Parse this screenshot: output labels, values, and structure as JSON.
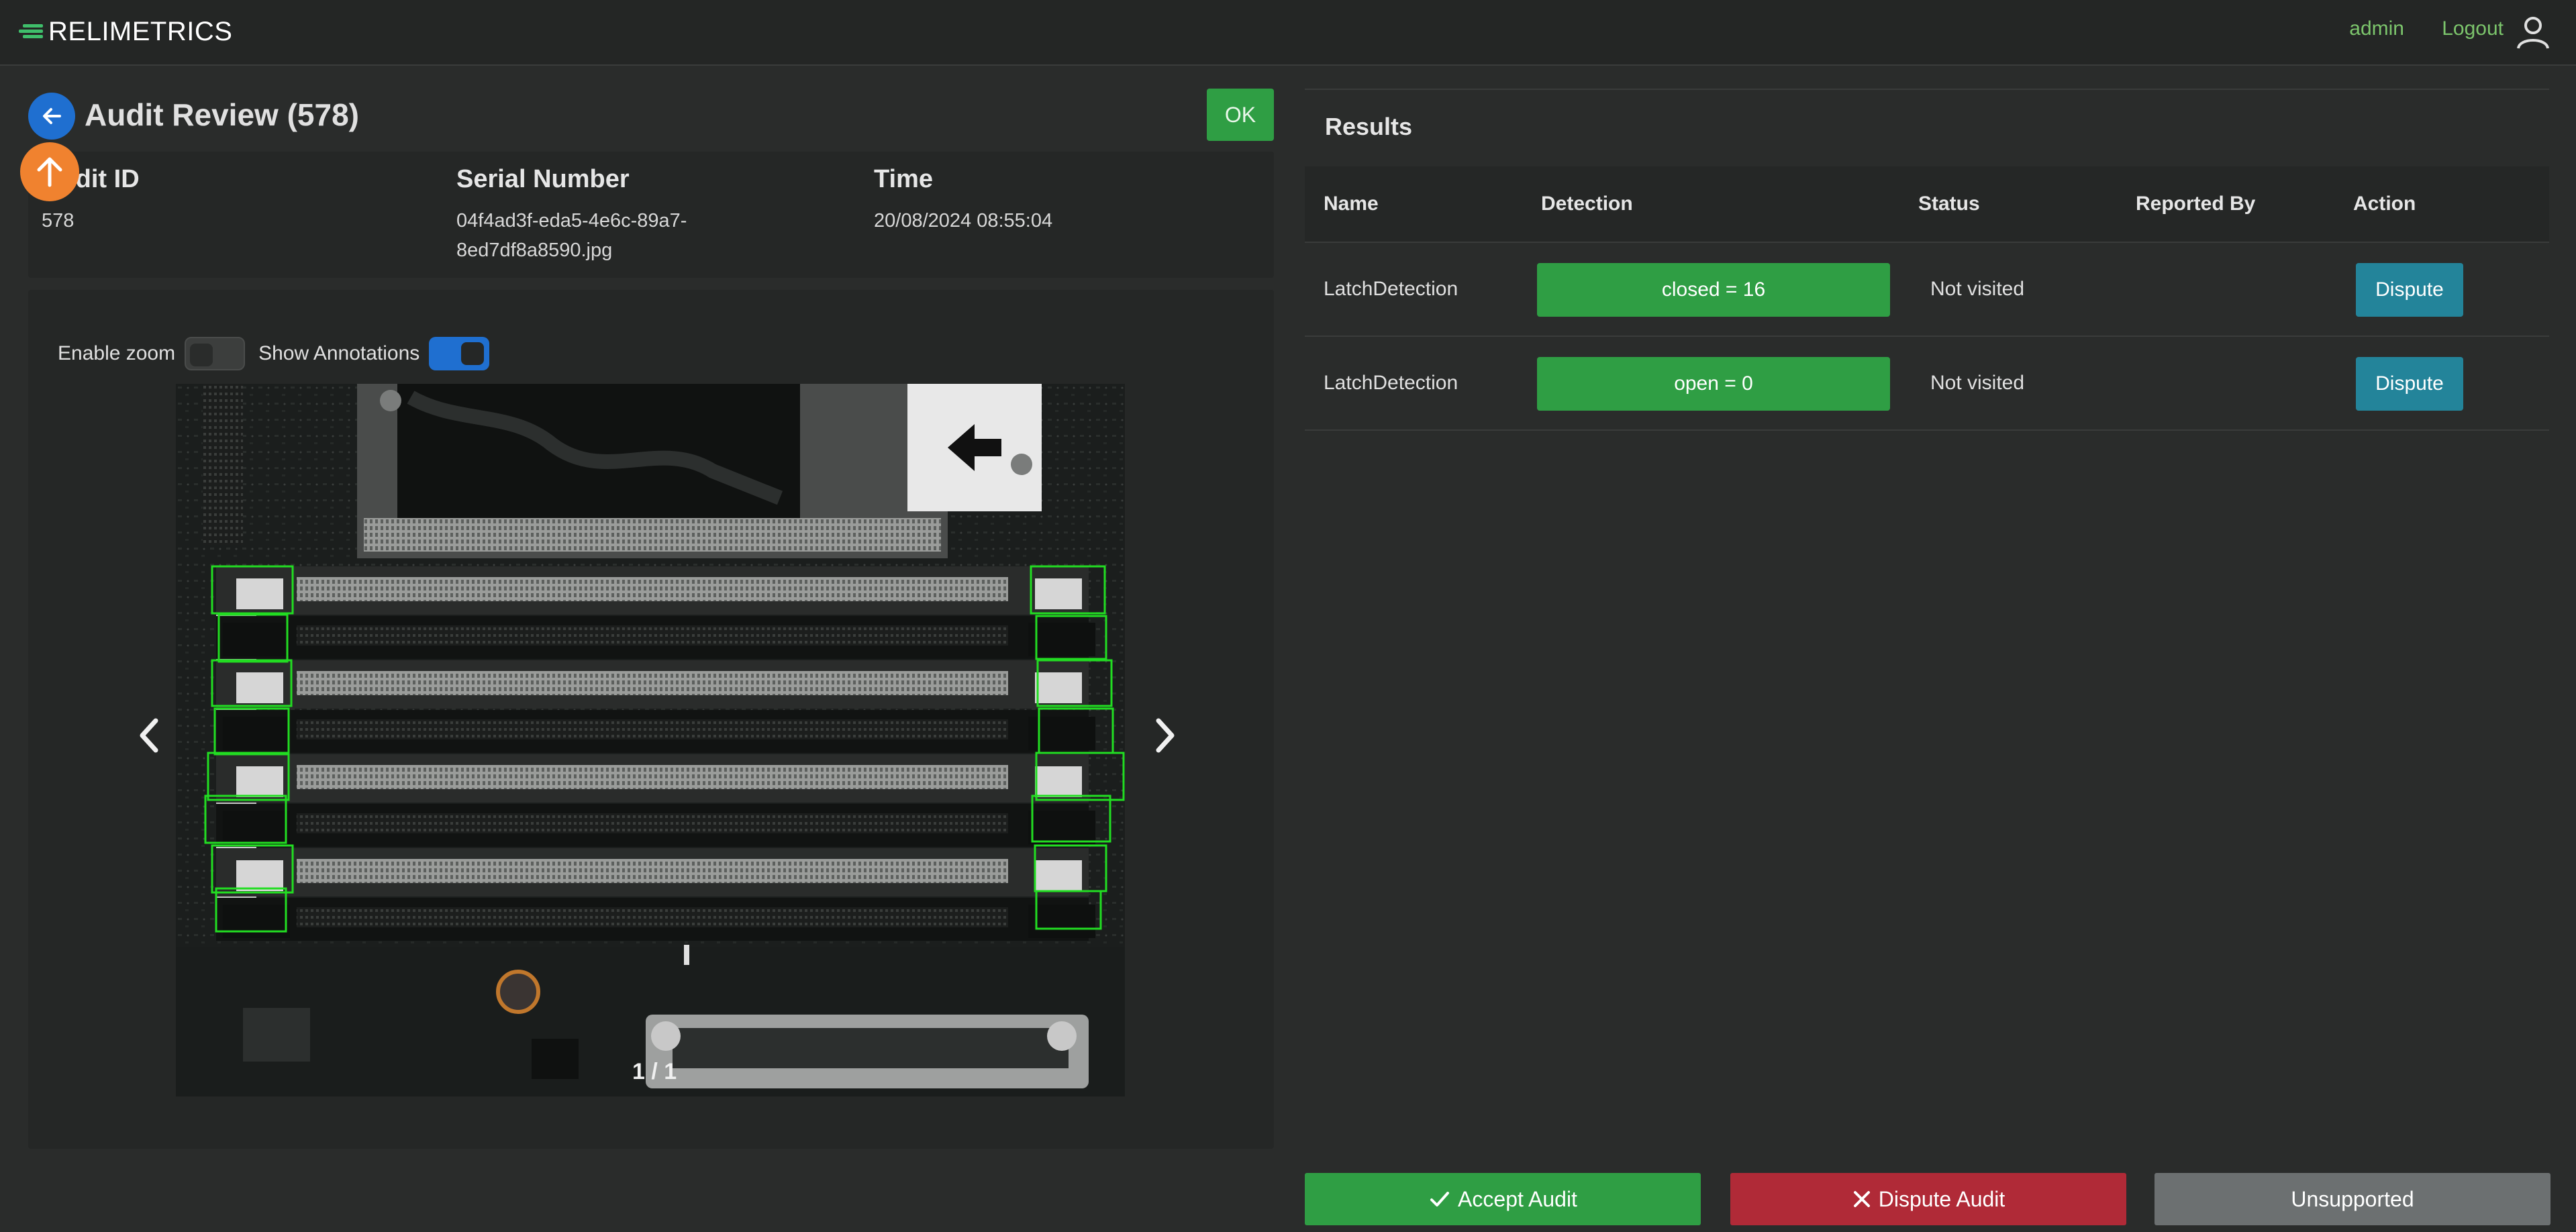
{
  "app": {
    "brand": "RELIMETRICS"
  },
  "nav": {
    "user": "admin",
    "logout": "Logout",
    "user_icon": "user-icon"
  },
  "page": {
    "title": "Audit Review (578)",
    "ok_label": "OK",
    "back_icon": "arrow-left-icon",
    "upload_icon": "arrow-up-icon"
  },
  "info": {
    "audit_id_label": "Audit ID",
    "audit_id_value": "578",
    "serial_label": "Serial Number",
    "serial_line1": "04f4ad3f-eda5-4e6c-89a7-",
    "serial_line2": "8ed7df8a8590.jpg",
    "time_label": "Time",
    "time_value": "20/08/2024 08:55:04"
  },
  "viewer": {
    "enable_zoom_label": "Enable zoom",
    "enable_zoom_on": false,
    "show_annotations_label": "Show Annotations",
    "show_annotations_on": true,
    "counter": "1 / 1"
  },
  "results": {
    "title": "Results",
    "columns": {
      "name": "Name",
      "detection": "Detection",
      "status": "Status",
      "reported_by": "Reported By",
      "action": "Action"
    },
    "rows": [
      {
        "name": "LatchDetection",
        "detection": "closed = 16",
        "status": "Not visited",
        "reported_by": "",
        "action": "Dispute"
      },
      {
        "name": "LatchDetection",
        "detection": "open = 0",
        "status": "Not visited",
        "reported_by": "",
        "action": "Dispute"
      }
    ]
  },
  "footer": {
    "accept_label": "Accept Audit",
    "dispute_label": "Dispute Audit",
    "unsupported_label": "Unsupported"
  },
  "colors": {
    "accent_green": "#2f9e44",
    "dispute_red": "#b02a37",
    "teal": "#23849a",
    "primary_blue": "#1f6fd0",
    "orange": "#f0822f"
  }
}
